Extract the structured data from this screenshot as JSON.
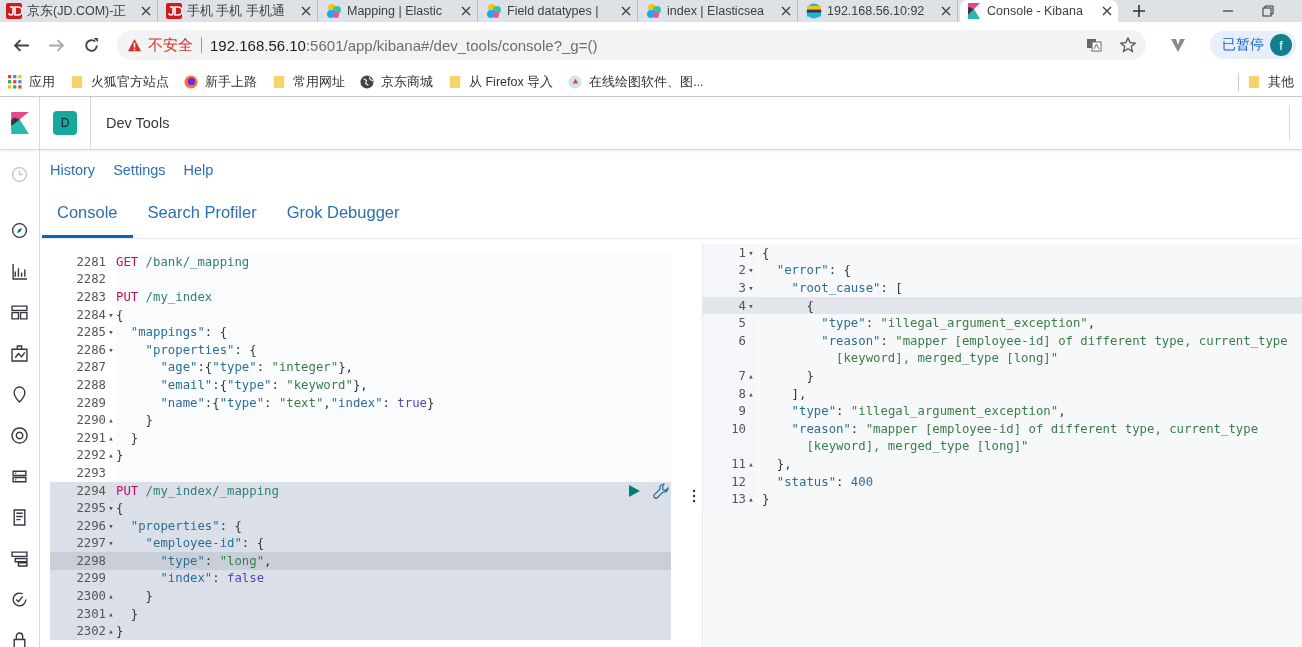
{
  "browser": {
    "tabs": [
      {
        "title": "京东(JD.COM)-正",
        "kind": "jd",
        "selected": false
      },
      {
        "title": "手机 手机 手机通",
        "kind": "jd",
        "selected": false
      },
      {
        "title": "Mapping | Elastic",
        "kind": "elastic",
        "selected": false
      },
      {
        "title": "Field datatypes |",
        "kind": "elastic",
        "selected": false
      },
      {
        "title": "index | Elasticsea",
        "kind": "elastic",
        "selected": false
      },
      {
        "title": "192.168.56.10:92",
        "kind": "stack",
        "selected": false
      },
      {
        "title": "Console - Kibana",
        "kind": "kibana",
        "selected": true
      }
    ],
    "address": {
      "security": "不安全",
      "host": "192.168.56.10",
      "path": ":5601/app/kibana#/dev_tools/console?_g=()"
    },
    "profile": {
      "label": "已暂停",
      "avatar": "f"
    },
    "bookmarks": [
      {
        "label": "应用",
        "kind": "apps"
      },
      {
        "label": "火狐官方站点",
        "kind": "folder"
      },
      {
        "label": "新手上路",
        "kind": "firefox"
      },
      {
        "label": "常用网址",
        "kind": "folder"
      },
      {
        "label": "京东商城",
        "kind": "globe"
      },
      {
        "label": "从 Firefox 导入",
        "kind": "folder"
      },
      {
        "label": "在线绘图软件、图...",
        "kind": "draw"
      }
    ],
    "other_bookmarks": {
      "label": "其他",
      "kind": "folder"
    }
  },
  "kibana": {
    "space": "D",
    "title": "Dev Tools",
    "links": [
      "History",
      "Settings",
      "Help"
    ],
    "tabs": [
      {
        "label": "Console",
        "selected": true
      },
      {
        "label": "Search Profiler",
        "selected": false
      },
      {
        "label": "Grok Debugger",
        "selected": false
      }
    ],
    "request": [
      {
        "n": "2281",
        "highlighted": false,
        "active": false,
        "tokens": [
          {
            "t": "GET",
            "kind": "method"
          },
          {
            "t": " /bank/_mapping",
            "kind": "path"
          }
        ]
      },
      {
        "n": "2282",
        "highlighted": false,
        "active": false
      },
      {
        "n": "2283",
        "highlighted": false,
        "active": false,
        "tokens": [
          {
            "t": "PUT",
            "kind": "method"
          },
          {
            "t": " /my_index",
            "kind": "path"
          }
        ]
      },
      {
        "n": "2284",
        "fold": "▾",
        "highlighted": false,
        "active": false,
        "tokens": [
          {
            "t": "{",
            "kind": "punct"
          }
        ]
      },
      {
        "n": "2285",
        "fold": "▾",
        "highlighted": false,
        "active": false,
        "tokens": [
          {
            "t": "  \"mappings\"",
            "kind": "key"
          },
          {
            "t": ": {",
            "kind": "punct"
          }
        ]
      },
      {
        "n": "2286",
        "fold": "▾",
        "highlighted": false,
        "active": false,
        "tokens": [
          {
            "t": "    \"properties\"",
            "kind": "key"
          },
          {
            "t": ": {",
            "kind": "punct"
          }
        ]
      },
      {
        "n": "2287",
        "highlighted": false,
        "active": false,
        "tokens": [
          {
            "t": "      \"age\"",
            "kind": "key"
          },
          {
            "t": ":{",
            "kind": "punct"
          },
          {
            "t": "\"type\"",
            "kind": "key"
          },
          {
            "t": ": ",
            "kind": "punct"
          },
          {
            "t": "\"integer\"",
            "kind": "string"
          },
          {
            "t": "},",
            "kind": "punct"
          }
        ]
      },
      {
        "n": "2288",
        "highlighted": false,
        "active": false,
        "tokens": [
          {
            "t": "      \"email\"",
            "kind": "key"
          },
          {
            "t": ":{",
            "kind": "punct"
          },
          {
            "t": "\"type\"",
            "kind": "key"
          },
          {
            "t": ": ",
            "kind": "punct"
          },
          {
            "t": "\"keyword\"",
            "kind": "string"
          },
          {
            "t": "},",
            "kind": "punct"
          }
        ]
      },
      {
        "n": "2289",
        "highlighted": false,
        "active": false,
        "tokens": [
          {
            "t": "      \"name\"",
            "kind": "key"
          },
          {
            "t": ":{",
            "kind": "punct"
          },
          {
            "t": "\"type\"",
            "kind": "key"
          },
          {
            "t": ": ",
            "kind": "punct"
          },
          {
            "t": "\"text\"",
            "kind": "string"
          },
          {
            "t": ",",
            "kind": "punct"
          },
          {
            "t": "\"index\"",
            "kind": "key"
          },
          {
            "t": ": ",
            "kind": "punct"
          },
          {
            "t": "true",
            "kind": "bool"
          },
          {
            "t": "}",
            "kind": "punct"
          }
        ]
      },
      {
        "n": "2290",
        "fold": "▴",
        "highlighted": false,
        "active": false,
        "tokens": [
          {
            "t": "    }",
            "kind": "punct"
          }
        ]
      },
      {
        "n": "2291",
        "fold": "▴",
        "highlighted": false,
        "active": false,
        "tokens": [
          {
            "t": "  }",
            "kind": "punct"
          }
        ]
      },
      {
        "n": "2292",
        "fold": "▴",
        "highlighted": false,
        "active": false,
        "tokens": [
          {
            "t": "}",
            "kind": "punct"
          }
        ]
      },
      {
        "n": "2293",
        "highlighted": false,
        "active": false
      },
      {
        "n": "2294",
        "highlighted": true,
        "active": false,
        "actions": true,
        "tokens": [
          {
            "t": "PUT",
            "kind": "method"
          },
          {
            "t": " /my_index/_mapping",
            "kind": "path"
          }
        ]
      },
      {
        "n": "2295",
        "fold": "▾",
        "highlighted": true,
        "active": false,
        "tokens": [
          {
            "t": "{",
            "kind": "punct"
          }
        ]
      },
      {
        "n": "2296",
        "fold": "▾",
        "highlighted": true,
        "active": false,
        "tokens": [
          {
            "t": "  \"properties\"",
            "kind": "key"
          },
          {
            "t": ": {",
            "kind": "punct"
          }
        ]
      },
      {
        "n": "2297",
        "fold": "▾",
        "highlighted": true,
        "active": false,
        "tokens": [
          {
            "t": "    \"employee-id\"",
            "kind": "key"
          },
          {
            "t": ": {",
            "kind": "punct"
          }
        ]
      },
      {
        "n": "2298",
        "highlighted": true,
        "active": true,
        "tokens": [
          {
            "t": "      \"type\"",
            "kind": "key"
          },
          {
            "t": ": ",
            "kind": "punct"
          },
          {
            "t": "\"long\"",
            "kind": "string"
          },
          {
            "t": ",",
            "kind": "punct"
          }
        ]
      },
      {
        "n": "2299",
        "highlighted": true,
        "active": false,
        "tokens": [
          {
            "t": "      \"index\"",
            "kind": "key"
          },
          {
            "t": ": ",
            "kind": "punct"
          },
          {
            "t": "false",
            "kind": "bool"
          }
        ]
      },
      {
        "n": "2300",
        "fold": "▴",
        "highlighted": true,
        "active": false,
        "tokens": [
          {
            "t": "    }",
            "kind": "punct"
          }
        ]
      },
      {
        "n": "2301",
        "fold": "▴",
        "highlighted": true,
        "active": false,
        "tokens": [
          {
            "t": "  }",
            "kind": "punct"
          }
        ]
      },
      {
        "n": "2302",
        "fold": "▴",
        "highlighted": true,
        "active": false,
        "tokens": [
          {
            "t": "}",
            "kind": "punct"
          }
        ]
      }
    ],
    "response": [
      {
        "n": "1",
        "fold": "▾",
        "active": false,
        "tokens": [
          {
            "t": "{",
            "kind": "punct"
          }
        ]
      },
      {
        "n": "2",
        "fold": "▾",
        "active": false,
        "tokens": [
          {
            "t": "  \"error\"",
            "kind": "key"
          },
          {
            "t": ": {",
            "kind": "punct"
          }
        ]
      },
      {
        "n": "3",
        "fold": "▾",
        "active": false,
        "tokens": [
          {
            "t": "    \"root_cause\"",
            "kind": "key"
          },
          {
            "t": ": [",
            "kind": "punct"
          }
        ]
      },
      {
        "n": "4",
        "fold": "▾",
        "active": true,
        "tokens": [
          {
            "t": "      {",
            "kind": "punct"
          }
        ]
      },
      {
        "n": "5",
        "active": false,
        "tokens": [
          {
            "t": "        \"type\"",
            "kind": "key"
          },
          {
            "t": ": ",
            "kind": "punct"
          },
          {
            "t": "\"illegal_argument_exception\"",
            "kind": "string"
          },
          {
            "t": ",",
            "kind": "punct"
          }
        ]
      },
      {
        "n": "6",
        "active": false,
        "tokens": [
          {
            "t": "        \"reason\"",
            "kind": "key"
          },
          {
            "t": ": ",
            "kind": "punct"
          },
          {
            "t": "\"mapper [employee-id] of different type, current_type",
            "kind": "string"
          }
        ],
        "continuation": [
          {
            "t": "          [keyword], merged_type [long]\"",
            "kind": "string"
          }
        ]
      },
      {
        "n": "7",
        "fold": "▴",
        "active": false,
        "tokens": [
          {
            "t": "      }",
            "kind": "punct"
          }
        ]
      },
      {
        "n": "8",
        "fold": "▴",
        "active": false,
        "tokens": [
          {
            "t": "    ],",
            "kind": "punct"
          }
        ]
      },
      {
        "n": "9",
        "active": false,
        "tokens": [
          {
            "t": "    \"type\"",
            "kind": "key"
          },
          {
            "t": ": ",
            "kind": "punct"
          },
          {
            "t": "\"illegal_argument_exception\"",
            "kind": "string"
          },
          {
            "t": ",",
            "kind": "punct"
          }
        ]
      },
      {
        "n": "10",
        "active": false,
        "tokens": [
          {
            "t": "    \"reason\"",
            "kind": "key"
          },
          {
            "t": ": ",
            "kind": "punct"
          },
          {
            "t": "\"mapper [employee-id] of different type, current_type",
            "kind": "string"
          }
        ],
        "continuation": [
          {
            "t": "      [keyword], merged_type [long]\"",
            "kind": "string"
          }
        ]
      },
      {
        "n": "11",
        "fold": "▴",
        "active": false,
        "tokens": [
          {
            "t": "  },",
            "kind": "punct"
          }
        ]
      },
      {
        "n": "12",
        "active": false,
        "tokens": [
          {
            "t": "  \"status\"",
            "kind": "key"
          },
          {
            "t": ": ",
            "kind": "punct"
          },
          {
            "t": "400",
            "kind": "number"
          }
        ]
      },
      {
        "n": "13",
        "fold": "▴",
        "active": false,
        "tokens": [
          {
            "t": "}",
            "kind": "punct"
          }
        ]
      }
    ]
  }
}
